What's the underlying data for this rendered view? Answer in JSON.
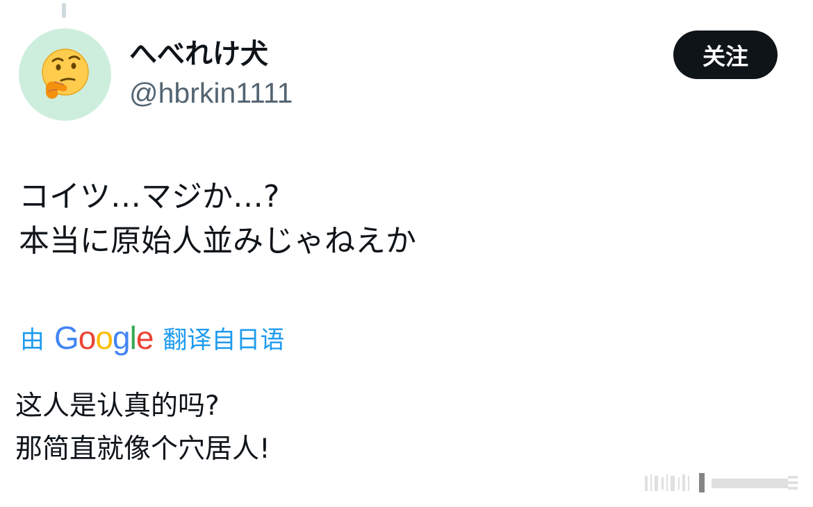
{
  "tweet": {
    "author": {
      "display_name": "へべれけ犬",
      "handle": "@hbrkin1111",
      "avatar_icon": "thinking-face-icon",
      "avatar_bg": "#cdeedd"
    },
    "follow_label": "关注",
    "text_lines": [
      "コイツ…マジか…?",
      "本当に原始人並みじゃねえか"
    ],
    "translation": {
      "prefix": "由",
      "brand_letters": [
        "G",
        "o",
        "o",
        "g",
        "l",
        "e"
      ],
      "suffix": "翻译自日语",
      "lines": [
        "这人是认真的吗?",
        "那简直就像个穴居人!"
      ]
    }
  },
  "colors": {
    "text": "#0f1419",
    "handle": "#536471",
    "link_blue": "#1d9bf0",
    "follow_bg": "#0f1419",
    "follow_text": "#ffffff"
  }
}
